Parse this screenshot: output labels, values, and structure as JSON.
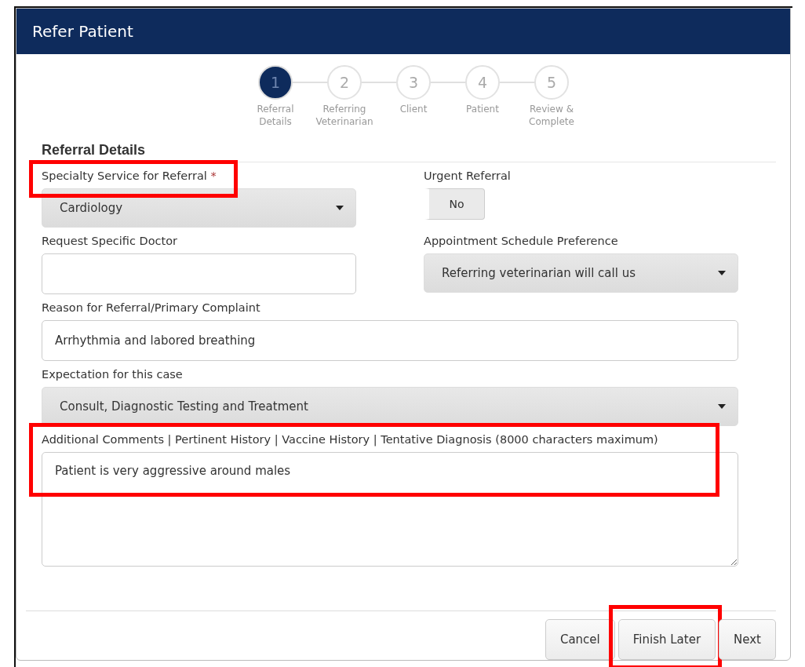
{
  "dialog": {
    "title": "Refer Patient"
  },
  "steps": [
    {
      "number": "1",
      "label": "Referral Details",
      "selected": true
    },
    {
      "number": "2",
      "label": "Referring Veterinarian",
      "selected": false
    },
    {
      "number": "3",
      "label": "Client",
      "selected": false
    },
    {
      "number": "4",
      "label": "Patient",
      "selected": false
    },
    {
      "number": "5",
      "label": "Review & Complete",
      "selected": false
    }
  ],
  "section_title": "Referral Details",
  "specialty": {
    "label": "Specialty Service for Referral",
    "required_mark": "*",
    "value": "Cardiology",
    "highlighted": true
  },
  "urgent": {
    "label": "Urgent Referral",
    "value": "No",
    "on": false
  },
  "doctor": {
    "label": "Request Specific Doctor"
  },
  "schedule": {
    "label": "Appointment Schedule Preference",
    "value": "Referring veterinarian will call us"
  },
  "reason": {
    "label": "Reason for Referral/Primary Complaint",
    "value": "Arrhythmia and labored breathing"
  },
  "expectation": {
    "label": "Expectation for this case",
    "value": "Consult, Diagnostic Testing and Treatment"
  },
  "comments": {
    "label": "Additional Comments | Pertinent History | Vaccine History | Tentative Diagnosis (8000 characters maximum)",
    "value": "Patient is very aggressive around males",
    "highlighted": true
  },
  "buttons": [
    {
      "label": "Cancel",
      "highlighted": false
    },
    {
      "label": "Finish Later",
      "highlighted": true
    },
    {
      "label": "Next",
      "highlighted": false
    }
  ]
}
